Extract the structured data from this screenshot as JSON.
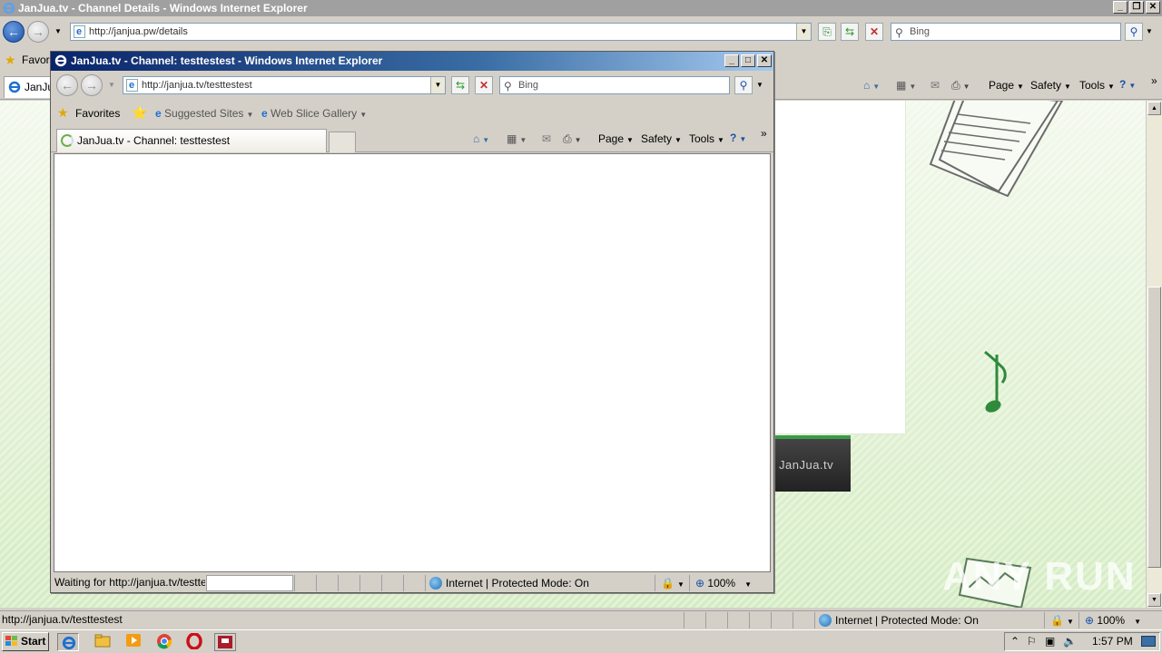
{
  "outer_window": {
    "title": "JanJua.tv - Channel Details - Windows Internet Explorer",
    "address": "http://janjua.pw/details",
    "search_placeholder": "Bing",
    "favorites_label": "Favori",
    "tab_label": "JanJu",
    "commands": {
      "page": "Page",
      "safety": "Safety",
      "tools": "Tools"
    },
    "status_text": "http://janjua.tv/testtestest",
    "zone": "Internet | Protected Mode: On",
    "zoom": "100%"
  },
  "page_content": {
    "brand": "JanJua.tv",
    "watermark": "ANY RUN"
  },
  "popup_window": {
    "title": "JanJua.tv - Channel: testtestest - Windows Internet Explorer",
    "address": "http://janjua.tv/testtestest",
    "search_placeholder": "Bing",
    "favorites_label": "Favorites",
    "suggested_sites": "Suggested Sites",
    "web_slice_gallery": "Web Slice Gallery",
    "tab_label": "JanJua.tv - Channel: testtestest",
    "commands": {
      "page": "Page",
      "safety": "Safety",
      "tools": "Tools"
    },
    "status_text": "Waiting for http://janjua.tv/testte",
    "zone": "Internet | Protected Mode: On",
    "zoom": "100%"
  },
  "taskbar": {
    "start_label": "Start",
    "clock": "1:57 PM"
  },
  "colors": {
    "popup_title_gradient_start": "#0a246a",
    "page_green": "#d4ecc2",
    "accent_green": "#3c9a46"
  }
}
